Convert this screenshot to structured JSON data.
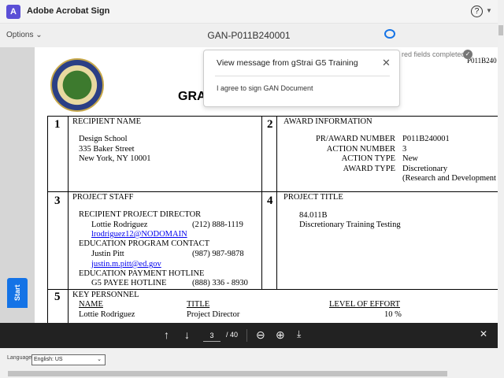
{
  "app": {
    "title": "Adobe Acrobat Sign",
    "help_icon": "help-icon"
  },
  "toolbar": {
    "options_label": "Options",
    "doc_title": "GAN-P011B240001"
  },
  "popover": {
    "title": "View message from gStrai G5 Training",
    "message": "I agree to sign GAN Document"
  },
  "status": {
    "required_text": "red fields completed",
    "header_ref": "P011B240"
  },
  "start_label": "Start",
  "document": {
    "title_partial": "GRA",
    "s1": {
      "num": "1",
      "head": "RECIPIENT NAME",
      "lines": [
        "Design School",
        "335 Baker Street",
        "New York, NY 10001"
      ]
    },
    "s2": {
      "num": "2",
      "head": "AWARD INFORMATION",
      "labels": [
        "PR/AWARD NUMBER",
        "ACTION NUMBER",
        "ACTION TYPE",
        "AWARD TYPE"
      ],
      "values": [
        "P011B240001",
        "3",
        "New",
        "Discretionary",
        "(Research and Development"
      ]
    },
    "s3": {
      "num": "3",
      "head": "PROJECT STAFF",
      "director_head": "RECIPIENT PROJECT DIRECTOR",
      "director_name": "Lottie Rodriguez",
      "director_phone": "(212) 888-1119",
      "director_email": "lrodriguez12@NODOMAIN",
      "contact_head": "EDUCATION PROGRAM CONTACT",
      "contact_name": "Justin Pitt",
      "contact_phone": "(987) 987-9878",
      "contact_email": "justin.m.pitt@ed.gov",
      "hotline_head": "EDUCATION PAYMENT HOTLINE",
      "hotline_name": "G5 PAYEE HOTLINE",
      "hotline_phone": "(888) 336 - 8930"
    },
    "s4": {
      "num": "4",
      "head": "PROJECT TITLE",
      "lines": [
        "84.011B",
        "Discretionary Training Testing"
      ]
    },
    "s5": {
      "num": "5",
      "head": "KEY PERSONNEL",
      "cols": [
        "NAME",
        "TITLE",
        "LEVEL OF EFFORT"
      ],
      "row": [
        "Lottie Rodriguez",
        "Project Director",
        "10 %"
      ]
    }
  },
  "pager": {
    "current": "3",
    "total": "/ 40"
  },
  "footer": {
    "language_label": "Language",
    "language_value": "English: US"
  }
}
